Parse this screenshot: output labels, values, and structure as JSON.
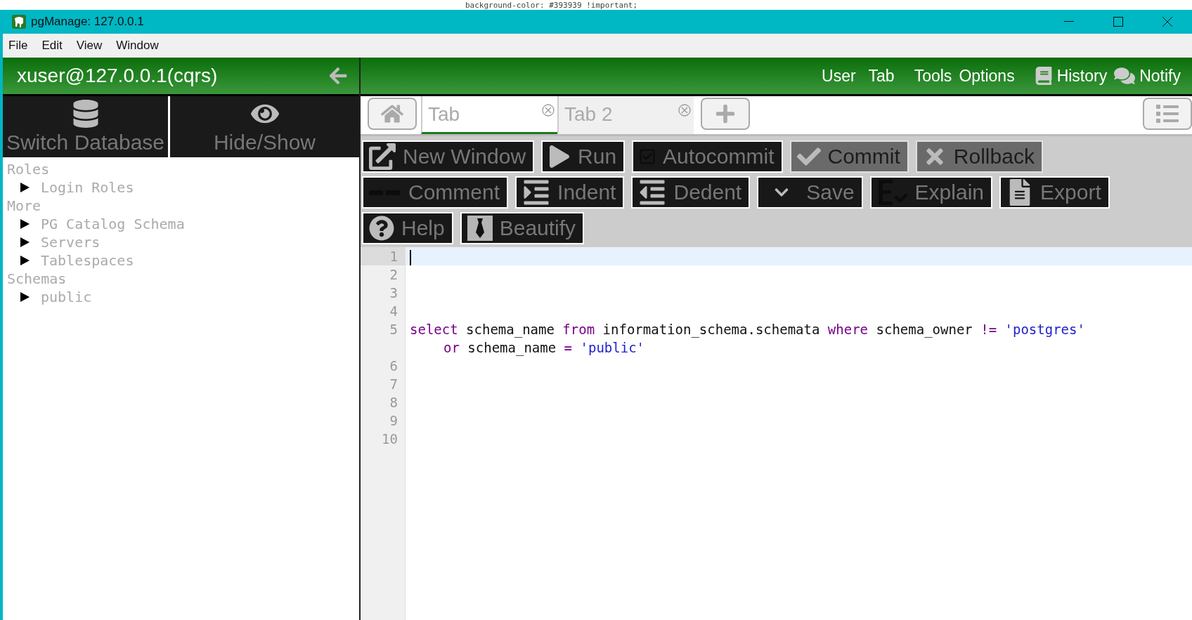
{
  "backdrop_text": "background-color: #393939 !important;",
  "window": {
    "title": "pgManage: 127.0.0.1"
  },
  "menu": [
    "File",
    "Edit",
    "View",
    "Window"
  ],
  "header": {
    "connection": "xuser@127.0.0.1(cqrs)",
    "links": [
      {
        "label": "User",
        "kind": "text"
      },
      {
        "label": "Tab",
        "kind": "text"
      },
      {
        "label": "Tools",
        "kind": "text"
      },
      {
        "label": "Options",
        "kind": "text"
      },
      {
        "label": "History",
        "kind": "book"
      },
      {
        "label": "Notify",
        "kind": "chat"
      }
    ]
  },
  "sidebar": {
    "buttons": [
      {
        "label": "Switch Database",
        "kind": "database"
      },
      {
        "label": "Hide/Show",
        "kind": "eye"
      }
    ],
    "tree": [
      {
        "label": "Roles",
        "children": [
          {
            "label": "Login Roles",
            "expanded": false
          }
        ]
      },
      {
        "label": "More",
        "children": [
          {
            "label": "PG Catalog Schema",
            "expanded": false
          },
          {
            "label": "Servers",
            "expanded": false
          },
          {
            "label": "Tablespaces",
            "expanded": false
          }
        ]
      },
      {
        "label": "Schemas",
        "children": [
          {
            "label": "public",
            "expanded": false
          }
        ]
      }
    ]
  },
  "tabs": [
    {
      "label": "Tab",
      "selected": true
    },
    {
      "label": "Tab 2",
      "selected": false
    }
  ],
  "toolbar": {
    "rows": [
      [
        {
          "label": "New Window",
          "kind": "new-window",
          "disabled": false
        },
        {
          "label": "Run",
          "kind": "run",
          "disabled": false
        },
        {
          "label": "Autocommit",
          "kind": "autocommit",
          "disabled": false
        },
        {
          "label": "Commit",
          "kind": "commit",
          "disabled": true
        },
        {
          "label": "Rollback",
          "kind": "rollback",
          "disabled": true
        }
      ],
      [
        {
          "label": "Comment",
          "kind": "comment",
          "disabled": false
        },
        {
          "label": "Indent",
          "kind": "indent",
          "disabled": false
        },
        {
          "label": "Dedent",
          "kind": "dedent",
          "disabled": false
        },
        {
          "label": "Save",
          "kind": "save",
          "disabled": false
        },
        {
          "label": "Explain",
          "kind": "explain",
          "disabled": false
        },
        {
          "label": "Export",
          "kind": "export",
          "disabled": false
        }
      ],
      [
        {
          "label": "Help",
          "kind": "help",
          "disabled": false
        },
        {
          "label": "Beautify",
          "kind": "beautify",
          "disabled": false
        }
      ]
    ]
  },
  "editor": {
    "lines": [
      {
        "number": "1",
        "active": true
      },
      {
        "number": "2",
        "active": false
      },
      {
        "number": "3",
        "active": false
      },
      {
        "number": "4",
        "active": false
      },
      {
        "number": "5",
        "active": false,
        "rows": [
          {
            "tokens": [
              {
                "kind": "keyword",
                "text": "select"
              },
              {
                "kind": "plain",
                "text": " schema_name "
              },
              {
                "kind": "keyword",
                "text": "from"
              },
              {
                "kind": "plain",
                "text": " information_schema.schemata "
              },
              {
                "kind": "keyword",
                "text": "where"
              },
              {
                "kind": "plain",
                "text": " schema_owner "
              },
              {
                "kind": "keyword",
                "text": "!= "
              },
              {
                "kind": "string",
                "text": "'postgres'"
              }
            ]
          },
          {
            "tokens": [
              {
                "kind": "keyword",
                "text": "or"
              },
              {
                "kind": "plain",
                "text": " schema_name "
              },
              {
                "kind": "keyword",
                "text": "= "
              },
              {
                "kind": "string",
                "text": "'public'"
              }
            ]
          }
        ]
      },
      {
        "number": "6",
        "active": false
      },
      {
        "number": "7",
        "active": false
      },
      {
        "number": "8",
        "active": false
      },
      {
        "number": "9",
        "active": false
      },
      {
        "number": "10",
        "active": false
      }
    ]
  }
}
